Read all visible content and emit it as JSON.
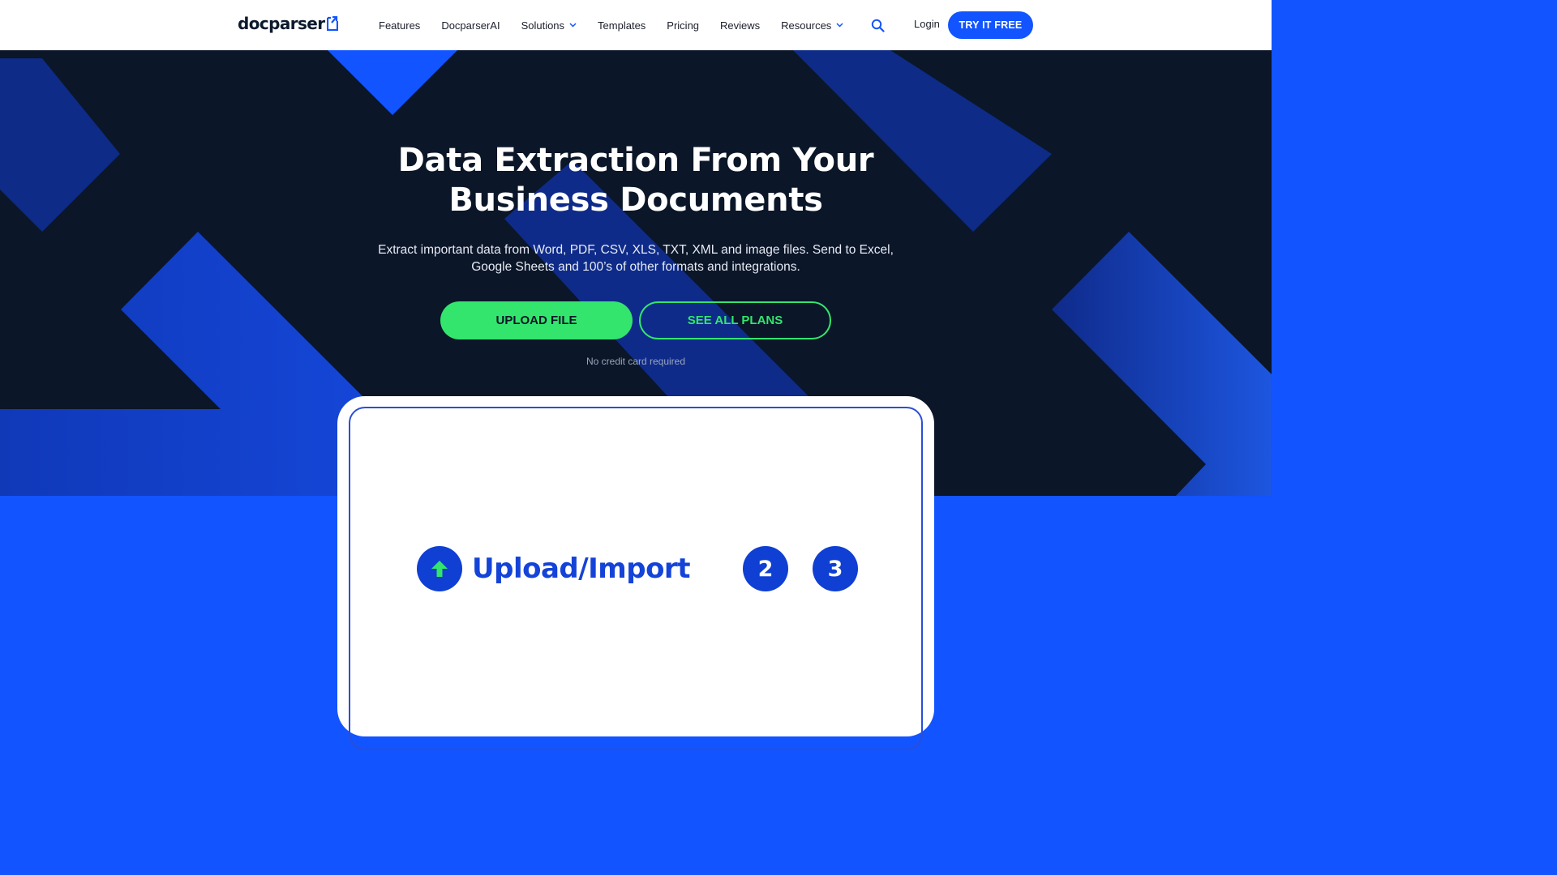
{
  "brand": {
    "name": "docparser",
    "colors": {
      "primary_blue": "#1254ff",
      "dark_navy": "#0b1628",
      "accent_green": "#33e56d"
    }
  },
  "nav": {
    "items": [
      {
        "label": "Features",
        "has_dropdown": false
      },
      {
        "label": "DocparserAI",
        "has_dropdown": false
      },
      {
        "label": "Solutions",
        "has_dropdown": true
      },
      {
        "label": "Templates",
        "has_dropdown": false
      },
      {
        "label": "Pricing",
        "has_dropdown": false
      },
      {
        "label": "Reviews",
        "has_dropdown": false
      },
      {
        "label": "Resources",
        "has_dropdown": true
      }
    ],
    "search_icon": "search-icon",
    "login_label": "Login",
    "cta_label": "TRY IT FREE"
  },
  "hero": {
    "title_line1": "Data Extraction From Your",
    "title_line2": "Business Documents",
    "subtitle_line1": "Extract important data from Word, PDF, CSV, XLS, TXT, XML and image files. Send to Excel,",
    "subtitle_line2": "Google Sheets and 100’s of other formats and integrations.",
    "primary_button": "UPLOAD FILE",
    "secondary_button": "SEE ALL PLANS",
    "note": "No credit card required"
  },
  "demo": {
    "steps": [
      {
        "icon": "upload-arrow-icon",
        "label": "Upload/Import",
        "active": true
      },
      {
        "number": "2",
        "active": false
      },
      {
        "number": "3",
        "active": false
      }
    ]
  }
}
